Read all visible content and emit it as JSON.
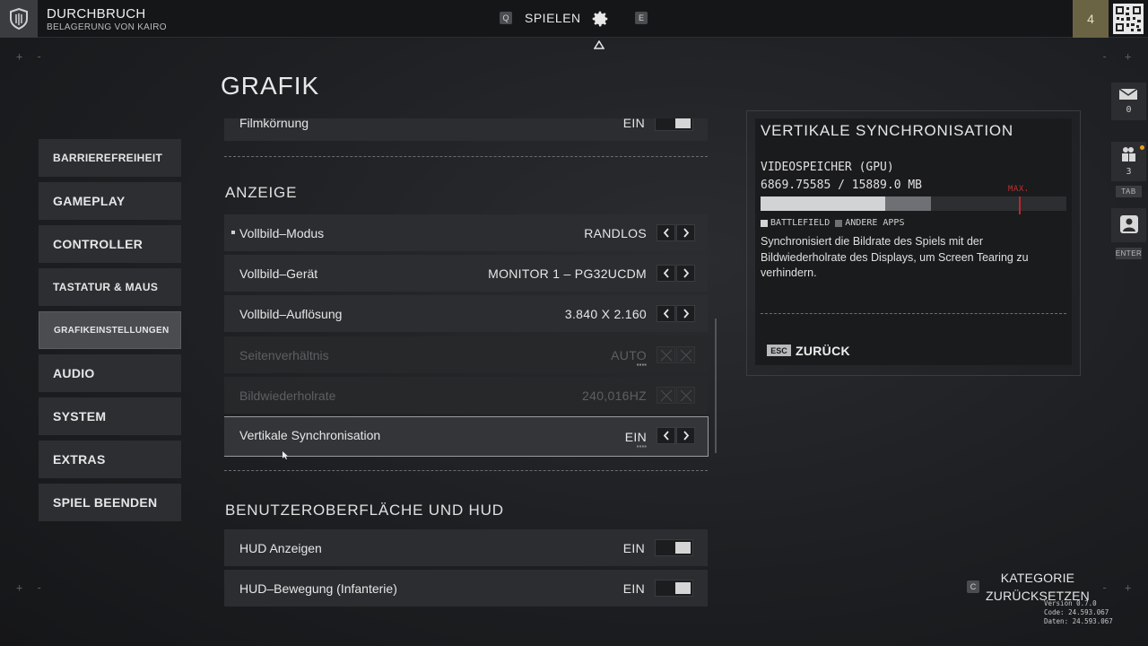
{
  "topbar": {
    "mode_title": "DURCHBRUCH",
    "mode_subtitle": "BELAGERUNG VON KAIRO",
    "left_key": "Q",
    "nav_label": "SPIELEN",
    "right_key": "E",
    "level": "4",
    "icons": [
      "shield-icon",
      "gear-icon",
      "qr-code-icon"
    ]
  },
  "page": {
    "title": "GRAFIK"
  },
  "nav": {
    "items": [
      {
        "label": "BARRIEREFREIHEIT"
      },
      {
        "label": "GAMEPLAY"
      },
      {
        "label": "CONTROLLER"
      },
      {
        "label": "TASTATUR & MAUS"
      },
      {
        "label": "GRAFIKEINSTELLUNGEN",
        "active": true
      },
      {
        "label": "AUDIO"
      },
      {
        "label": "SYSTEM"
      },
      {
        "label": "EXTRAS"
      },
      {
        "label": "SPIEL BEENDEN"
      }
    ]
  },
  "settings": {
    "filmgrain": {
      "label": "Filmkörnung",
      "value": "EIN"
    },
    "section_display": "ANZEIGE",
    "display_rows": [
      {
        "label": "Vollbild–Modus",
        "value": "RANDLOS"
      },
      {
        "label": "Vollbild–Gerät",
        "value": "MONITOR 1 – PG32UCDM"
      },
      {
        "label": "Vollbild–Auflösung",
        "value": "3.840 X 2.160"
      },
      {
        "label": "Seitenverhältnis",
        "value": "AUTO",
        "disabled": true
      },
      {
        "label": "Bildwiederholrate",
        "value": "240,016HZ",
        "disabled": true
      },
      {
        "label": "Vertikale Synchronisation",
        "value": "EIN",
        "selected": true
      }
    ],
    "section_hud": "BENUTZEROBERFLÄCHE UND HUD",
    "hud_rows": [
      {
        "label": "HUD Anzeigen",
        "value": "EIN"
      },
      {
        "label": "HUD–Bewegung (Infanterie)",
        "value": "EIN"
      }
    ]
  },
  "info": {
    "title": "VERTIKALE SYNCHRONISATION",
    "vram_label": "VIDEOSPEICHER (GPU)",
    "vram_value": "6869.75585 / 15889.0 MB",
    "vram_used_mb": 6869.75585,
    "vram_total_mb": 15889.0,
    "vram_battlefield_fraction": 0.408,
    "vram_other_fraction": 0.15,
    "vram_max_fraction": 0.846,
    "max_label": "MAX.",
    "legend_battlefield": "BATTLEFIELD",
    "legend_other": "ANDERE APPS",
    "description": "Synchronisiert die Bildrate des Spiels mit der Bildwiederholrate des Displays, um Screen Tearing zu verhindern.",
    "back_key": "ESC",
    "back_label": "ZURÜCK"
  },
  "rail": {
    "mail_count": "0",
    "squad_count": "3",
    "squad_key": "TAB",
    "profile_key": "ENTER"
  },
  "footer": {
    "reset_key": "C",
    "reset_label": "KATEGORIE ZURÜCKSETZEN",
    "version_lines": [
      "Version 0.7.0",
      "Code: 24.593.067",
      "Daten: 24.593.067"
    ]
  },
  "colors": {
    "accent_level": "#6b6444",
    "max_marker": "#b8282a",
    "bar_battlefield": "#d2d3d5",
    "bar_other": "#6f7073"
  }
}
